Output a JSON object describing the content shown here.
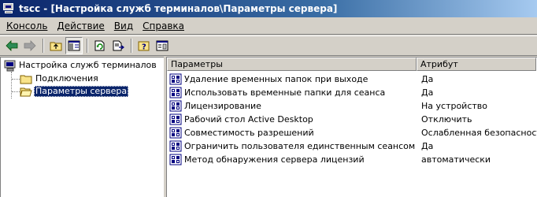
{
  "window": {
    "title": "tscc - [Настройка служб терминалов\\Параметры сервера]"
  },
  "menu": {
    "items": [
      "Консоль",
      "Действие",
      "Вид",
      "Справка"
    ]
  },
  "toolbar": {
    "buttons": [
      "back-icon",
      "forward-icon",
      "up-folder-icon",
      "show-hide-tree-icon",
      "refresh-icon",
      "export-list-icon",
      "help-icon",
      "properties-icon"
    ]
  },
  "tree": {
    "root": "Настройка служб терминалов",
    "children": [
      "Подключения",
      "Параметры сервера"
    ],
    "selected": "Параметры сервера"
  },
  "list": {
    "columns": [
      "Параметры",
      "Атрибут"
    ],
    "rows": [
      {
        "name": "Удаление временных папок при выходе",
        "value": "Да"
      },
      {
        "name": "Использовать временные папки для сеанса",
        "value": "Да"
      },
      {
        "name": "Лицензирование",
        "value": "На устройство"
      },
      {
        "name": "Рабочий стол Active Desktop",
        "value": "Отключить"
      },
      {
        "name": "Совместимость разрешений",
        "value": "Ослабленная безопасность"
      },
      {
        "name": "Ограничить пользователя единственным сеансом",
        "value": "Да"
      },
      {
        "name": "Метод обнаружения сервера лицензий",
        "value": "автоматически"
      }
    ]
  },
  "colors": {
    "title_active": "#0a246a",
    "face": "#d4d0c8",
    "selection": "#0a246a"
  }
}
